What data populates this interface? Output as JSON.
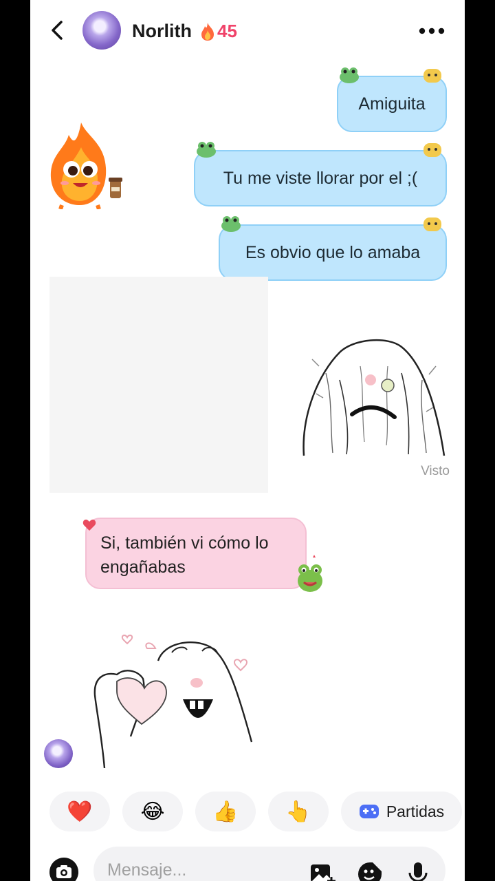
{
  "header": {
    "contact_name": "Norlith",
    "streak_count": "45",
    "back_icon": "chevron-left-icon",
    "more_icon": "more-horizontal-icon"
  },
  "messages": [
    {
      "direction": "outgoing",
      "text": "Amiguita"
    },
    {
      "direction": "outgoing",
      "text": "Tu me viste llorar por el ;("
    },
    {
      "direction": "outgoing",
      "text": "Es obvio que lo amaba"
    },
    {
      "direction": "outgoing",
      "type": "sticker",
      "sticker": "crying-meme-sticker"
    },
    {
      "direction": "incoming",
      "text": "Si, también vi cómo lo engañabas"
    },
    {
      "direction": "incoming",
      "type": "sticker",
      "sticker": "heart-hands-meme-sticker"
    }
  ],
  "seen_status": "Visto",
  "quick_reactions": [
    {
      "emoji": "❤️",
      "icon": "heart-icon"
    },
    {
      "emoji": "😂",
      "icon": "laughing-icon"
    },
    {
      "emoji": "👍",
      "icon": "thumbs-up-icon"
    },
    {
      "emoji": "👆",
      "icon": "pointing-up-icon"
    }
  ],
  "games_chip": {
    "label": "Partidas",
    "icon": "gamepad-icon"
  },
  "composer": {
    "placeholder": "Mensaje..."
  },
  "colors": {
    "outgoing_bubble": "#bfe6fd",
    "incoming_bubble": "#fbd3e2",
    "streak": "#f0436a",
    "games_icon": "#4c6ef5"
  }
}
